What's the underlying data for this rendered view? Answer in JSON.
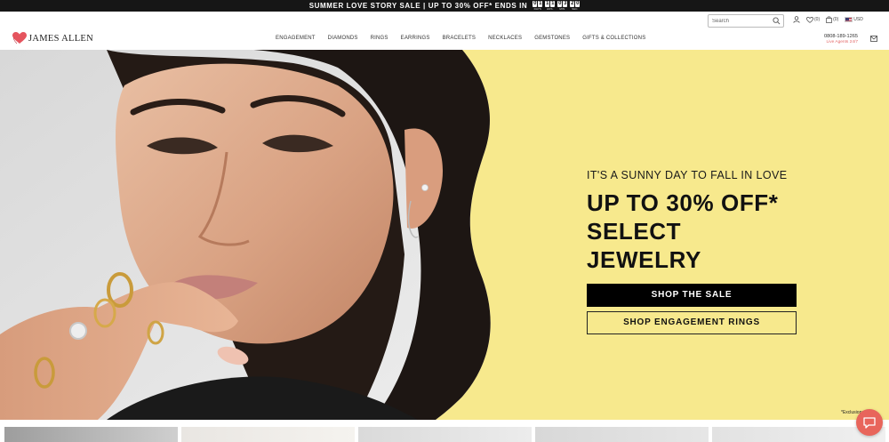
{
  "promo": {
    "text": "SUMMER LOVE STORY SALE | UP TO 30% OFF* ENDS IN",
    "countdown": [
      {
        "digits": [
          "0",
          "1"
        ],
        "label": "DAYS"
      },
      {
        "digits": [
          "1",
          "1"
        ],
        "label": "HRS."
      },
      {
        "digits": [
          "0",
          "3"
        ],
        "label": "MIN."
      },
      {
        "digits": [
          "2",
          "0"
        ],
        "label": "SEC."
      }
    ]
  },
  "header": {
    "logo": "JAMES ALLEN",
    "search_placeholder": "Search",
    "wishlist_count": "(0)",
    "cart_count": "(0)",
    "currency": "USD",
    "nav": [
      "ENGAGEMENT",
      "DIAMONDS",
      "RINGS",
      "EARRINGS",
      "BRACELETS",
      "NECKLACES",
      "GEMSTONES",
      "GIFTS & COLLECTIONS"
    ],
    "phone": "0808-189-1265",
    "phone_sub": "Live Agents 24/7"
  },
  "hero": {
    "kicker": "IT'S A SUNNY DAY TO FALL IN LOVE",
    "headline_line1": "UP TO 30% OFF*",
    "headline_line2": "SELECT JEWELRY",
    "cta_primary": "SHOP THE SALE",
    "cta_secondary": "SHOP ENGAGEMENT RINGS",
    "exclusions": "*Exclusions apply"
  },
  "colors": {
    "promo_bg": "#161616",
    "hero_bg": "#f7e98d",
    "brand_heart": "#e5545e",
    "chat": "#e8655b",
    "phone_sub": "#e46a6a"
  },
  "icons": [
    "search-icon",
    "user-icon",
    "heart-icon",
    "bag-icon",
    "flag-icon",
    "mail-icon",
    "chat-icon"
  ]
}
